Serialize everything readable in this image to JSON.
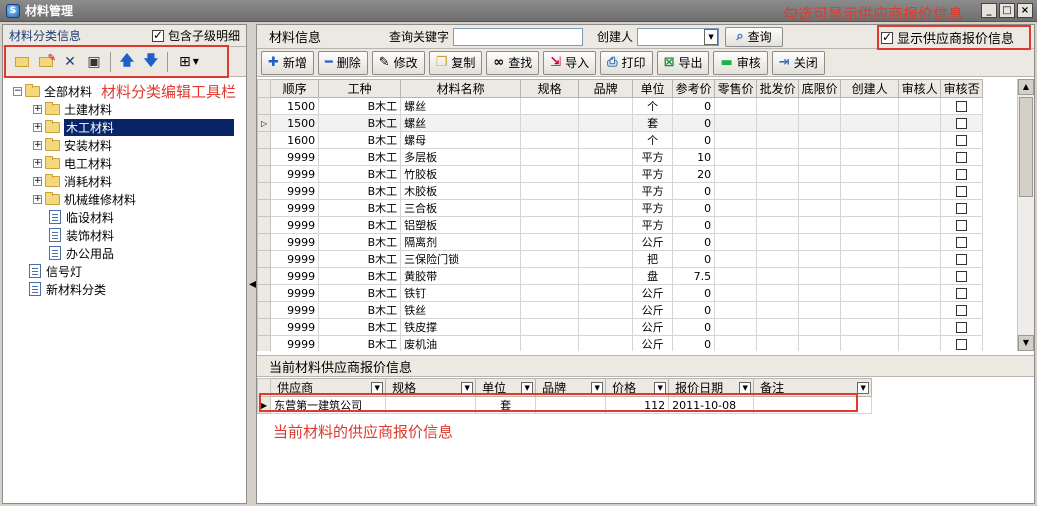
{
  "window": {
    "title": "材料管理",
    "controls": [
      "_",
      "□",
      "×"
    ]
  },
  "annotations": {
    "checkbox_hint": "勾选可显示供应商报价信息",
    "toolbar_hint": "材料分类编辑工具栏",
    "supplier_hint": "当前材料的供应商报价信息",
    "color": "#e03a2f"
  },
  "left": {
    "title": "材料分类信息",
    "include_children_label": "包含子级明细",
    "include_children_checked": true,
    "toolbar_icons": [
      "folder-open-icon",
      "edit-folder-icon",
      "delete-icon",
      "refresh-icon",
      "move-up-icon",
      "move-down-icon",
      "layout-icon"
    ],
    "tree": {
      "root": "全部材料",
      "children": [
        {
          "label": "土建材料",
          "type": "folder"
        },
        {
          "label": "木工材料",
          "type": "folder",
          "selected": true
        },
        {
          "label": "安装材料",
          "type": "folder"
        },
        {
          "label": "电工材料",
          "type": "folder"
        },
        {
          "label": "消耗材料",
          "type": "folder"
        },
        {
          "label": "机械维修材料",
          "type": "folder"
        },
        {
          "label": "临设材料",
          "type": "doc"
        },
        {
          "label": "装饰材料",
          "type": "doc"
        },
        {
          "label": "办公用品",
          "type": "doc"
        }
      ],
      "top_level_docs": [
        "信号灯",
        "新材料分类"
      ]
    }
  },
  "right": {
    "title": "材料信息",
    "search_label": "查询关键字",
    "search_value": "",
    "creator_label": "创建人",
    "creator_value": "",
    "query_button": "查询",
    "show_supplier_label": "显示供应商报价信息",
    "show_supplier_checked": true,
    "actions": [
      "新增",
      "删除",
      "修改",
      "复制",
      "查找",
      "导入",
      "打印",
      "导出",
      "审核",
      "关闭"
    ],
    "columns": [
      "顺序",
      "工种",
      "材料名称",
      "规格",
      "品牌",
      "单位",
      "参考价",
      "零售价",
      "批发价",
      "底限价",
      "创建人",
      "审核人",
      "审核否"
    ],
    "rows": [
      {
        "order": "1500",
        "trade": "B木工",
        "name": "螺丝",
        "unit": "个",
        "price": "0"
      },
      {
        "order": "1500",
        "trade": "B木工",
        "name": "螺丝",
        "unit": "套",
        "price": "0",
        "current": true
      },
      {
        "order": "1600",
        "trade": "B木工",
        "name": "螺母",
        "unit": "个",
        "price": "0"
      },
      {
        "order": "9999",
        "trade": "B木工",
        "name": "多层板",
        "unit": "平方",
        "price": "10"
      },
      {
        "order": "9999",
        "trade": "B木工",
        "name": "竹胶板",
        "unit": "平方",
        "price": "20"
      },
      {
        "order": "9999",
        "trade": "B木工",
        "name": "木胶板",
        "unit": "平方",
        "price": "0"
      },
      {
        "order": "9999",
        "trade": "B木工",
        "name": "三合板",
        "unit": "平方",
        "price": "0"
      },
      {
        "order": "9999",
        "trade": "B木工",
        "name": "铝塑板",
        "unit": "平方",
        "price": "0"
      },
      {
        "order": "9999",
        "trade": "B木工",
        "name": "隔离剂",
        "unit": "公斤",
        "price": "0"
      },
      {
        "order": "9999",
        "trade": "B木工",
        "name": "三保险门锁",
        "unit": "把",
        "price": "0"
      },
      {
        "order": "9999",
        "trade": "B木工",
        "name": "黄胶带",
        "unit": "盘",
        "price": "7.5"
      },
      {
        "order": "9999",
        "trade": "B木工",
        "name": "铁钉",
        "unit": "公斤",
        "price": "0"
      },
      {
        "order": "9999",
        "trade": "B木工",
        "name": "铁丝",
        "unit": "公斤",
        "price": "0"
      },
      {
        "order": "9999",
        "trade": "B木工",
        "name": "铁皮撑",
        "unit": "公斤",
        "price": "0"
      },
      {
        "order": "9999",
        "trade": "B木工",
        "name": "废机油",
        "unit": "公斤",
        "price": "0"
      }
    ]
  },
  "supplier": {
    "title": "当前材料供应商报价信息",
    "columns": [
      "供应商",
      "规格",
      "单位",
      "品牌",
      "价格",
      "报价日期",
      "备注"
    ],
    "rows": [
      {
        "supplier": "东营第一建筑公司",
        "spec": "",
        "unit": "套",
        "brand": "",
        "price": "112",
        "date": "2011-10-08",
        "remark": ""
      }
    ]
  }
}
